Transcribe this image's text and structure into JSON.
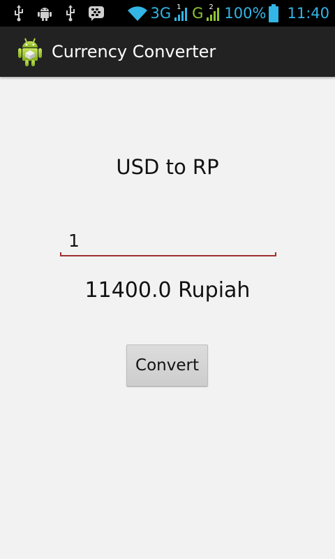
{
  "status_bar": {
    "icons": [
      "usb-icon",
      "android-debug-icon",
      "usb-icon",
      "bbm-icon",
      "wifi-icon",
      "signal-icon",
      "signal-icon",
      "battery-icon"
    ],
    "network_1": "3G",
    "sim_1": "1",
    "network_2": "G",
    "sim_2": "2",
    "battery": "100%",
    "time": "11:40",
    "accent_color": "#33b5e5",
    "g_color": "#8fc435"
  },
  "action_bar": {
    "title": "Currency Converter",
    "icon": "android-robot-icon"
  },
  "converter": {
    "heading": "USD to RP",
    "amount_value": "1",
    "result": "11400.0 Rupiah",
    "convert_label": "Convert",
    "underline_color": "#a12f2f"
  }
}
